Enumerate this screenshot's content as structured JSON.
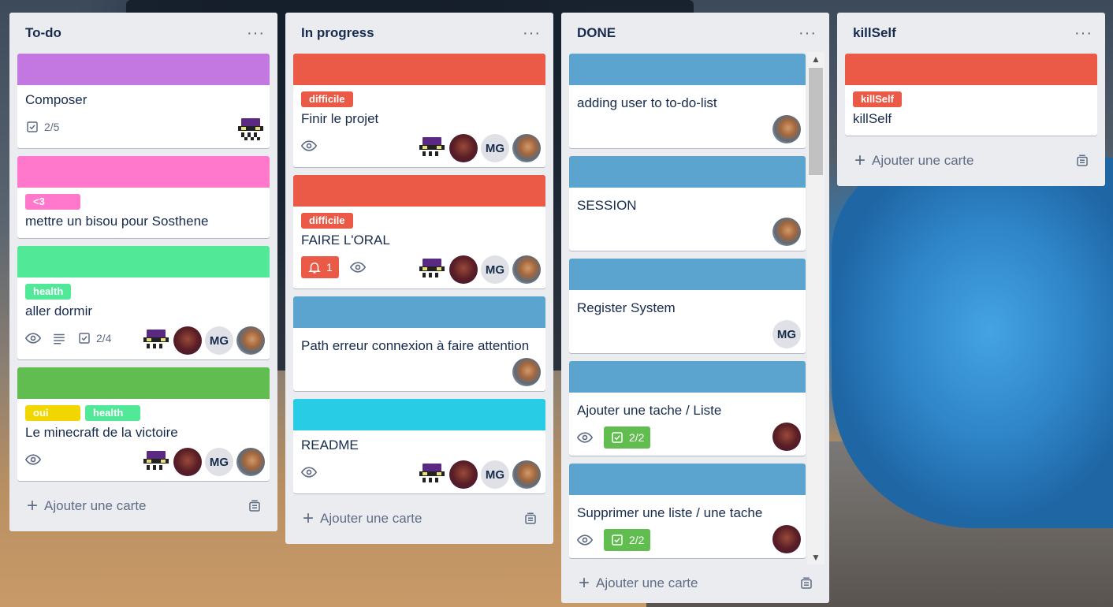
{
  "lists": [
    {
      "title": "To-do",
      "add_label": "Ajouter une carte",
      "cards": [
        {
          "cover": "#c377e0",
          "labels": [],
          "title": "Composer",
          "checklist": "2/5"
        },
        {
          "cover": "#ff78cb",
          "labels": [
            {
              "text": "<3",
              "color": "#ff78cb"
            }
          ],
          "title": "mettre un bisou pour Sosthene"
        },
        {
          "cover": "#51e898",
          "labels": [
            {
              "text": "health",
              "color": "#51e898"
            }
          ],
          "title": "aller dormir",
          "checklist": "2/4"
        },
        {
          "cover": "#61bd4f",
          "labels": [
            {
              "text": "oui",
              "color": "#f2d600"
            },
            {
              "text": "health",
              "color": "#51e898"
            }
          ],
          "title": "Le minecraft de la victoire"
        }
      ]
    },
    {
      "title": "In progress",
      "add_label": "Ajouter une carte",
      "cards": [
        {
          "cover": "#eb5a46",
          "labels": [
            {
              "text": "difficile",
              "color": "#eb5a46"
            }
          ],
          "title": "Finir le projet"
        },
        {
          "cover": "#eb5a46",
          "labels": [
            {
              "text": "difficile",
              "color": "#eb5a46"
            }
          ],
          "title": "FAIRE L'ORAL",
          "notification": "1"
        },
        {
          "cover": "#5ba4cf",
          "labels": [],
          "title": "Path erreur connexion à faire attention"
        },
        {
          "cover": "#29cce5",
          "labels": [],
          "title": "README"
        }
      ]
    },
    {
      "title": "DONE",
      "add_label": "Ajouter une carte",
      "cards": [
        {
          "cover": "#5ba4cf",
          "title": "adding user to to-do-list"
        },
        {
          "cover": "#5ba4cf",
          "title": "SESSION"
        },
        {
          "cover": "#5ba4cf",
          "title": "Register System"
        },
        {
          "cover": "#5ba4cf",
          "title": "Ajouter une tache / Liste",
          "checklist": "2/2"
        },
        {
          "cover": "#5ba4cf",
          "title": "Supprimer une liste / une tache",
          "checklist": "2/2"
        }
      ]
    },
    {
      "title": "killSelf",
      "add_label": "Ajouter une carte",
      "cards": [
        {
          "cover": "#eb5a46",
          "labels": [
            {
              "text": "killSelf",
              "color": "#eb5a46"
            }
          ],
          "title": "killSelf"
        }
      ]
    }
  ],
  "member_initials": "MG",
  "list_menu": "···",
  "colors": {
    "list_bg": "#ebecf0",
    "text": "#172b4d",
    "muted": "#5e6c84"
  }
}
